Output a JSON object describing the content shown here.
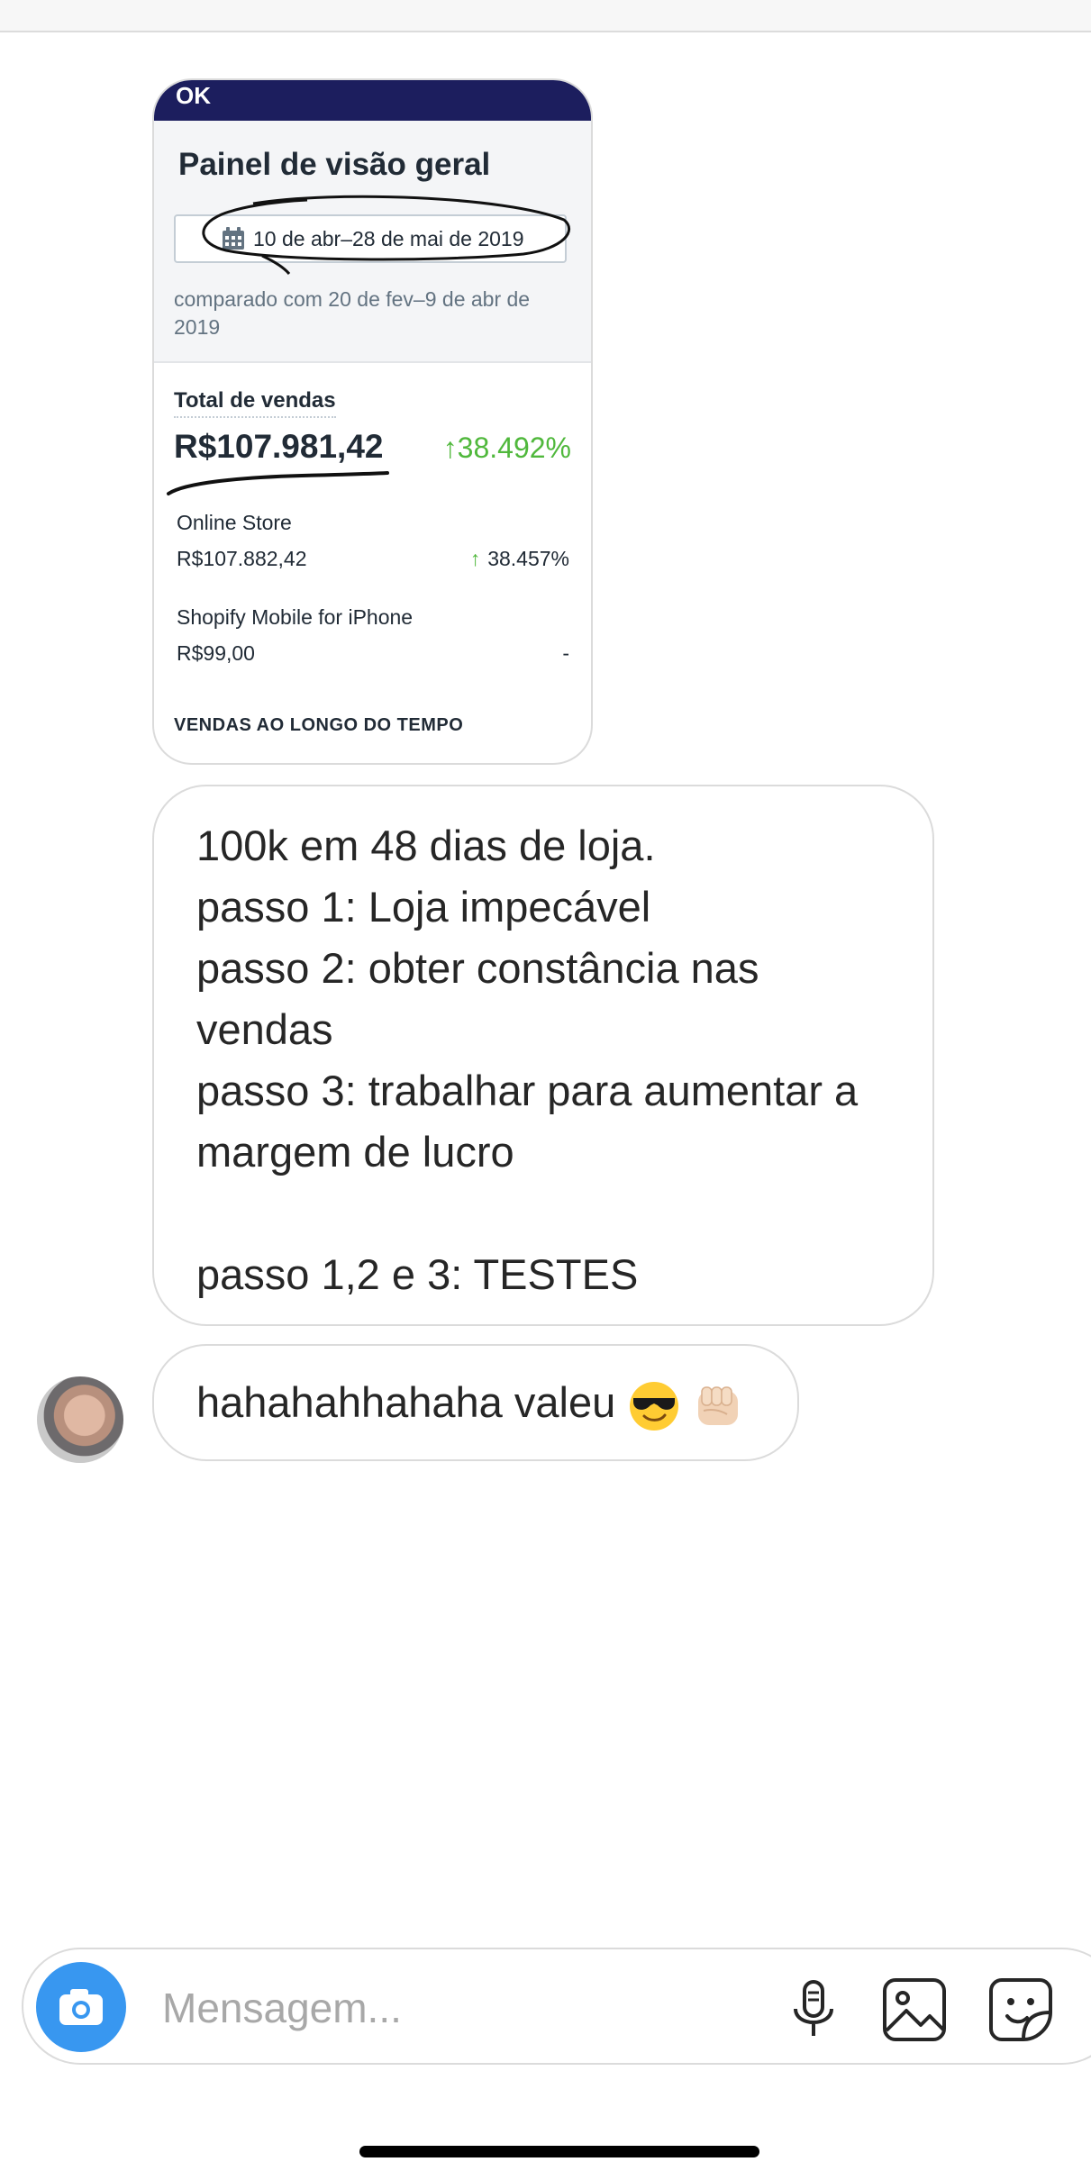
{
  "shared_screenshot": {
    "navbar_fragment": "OK",
    "title": "Painel de visão geral",
    "date_range": "10 de abr–28 de mai de 2019",
    "comparison": "comparado com 20 de fev–9 de abr de 2019",
    "total_sales_label": "Total de vendas",
    "total_sales_value": "R$107.981,42",
    "total_sales_change": "38.492%",
    "channels": [
      {
        "name": "Online Store",
        "value": "R$107.882,42",
        "change": "38.457%",
        "trend": "up"
      },
      {
        "name": "Shopify Mobile for iPhone",
        "value": "R$99,00",
        "change": "-",
        "trend": "none"
      }
    ],
    "section_heading": "VENDAS AO LONGO DO TEMPO",
    "accent_color": "#50b83c",
    "navbar_color": "#1c1e5e"
  },
  "messages": {
    "main_text": "100k em 48 dias de loja.\npasso 1: Loja impecável\npasso 2: obter constância nas vendas\npasso 3: trabalhar para aumentar a margem de lucro\n\npasso 1,2 e 3: TESTES",
    "reply_text": "hahahahhahaha valeu",
    "reply_emojis": [
      "smiling-face-with-sunglasses",
      "oncoming-fist-light-skin-tone"
    ]
  },
  "composer": {
    "placeholder": "Mensagem...",
    "value": "",
    "icons": [
      "camera-icon",
      "microphone-icon",
      "gallery-icon",
      "sticker-icon"
    ],
    "camera_color": "#3897f0"
  }
}
